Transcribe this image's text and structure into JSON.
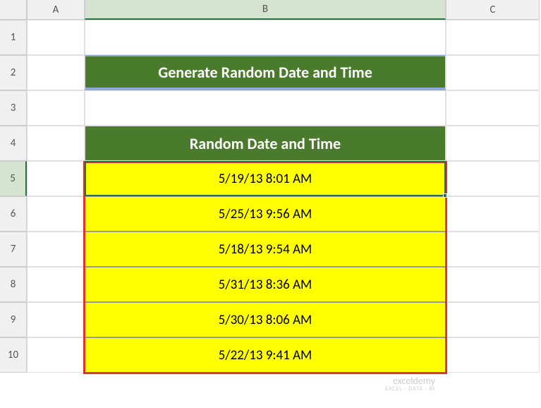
{
  "columns": [
    "A",
    "B",
    "C"
  ],
  "rows": [
    "1",
    "2",
    "3",
    "4",
    "5",
    "6",
    "7",
    "8",
    "9",
    "10"
  ],
  "selected_column": "B",
  "selected_row": "5",
  "title": "Generate Random Date and Time",
  "section_header": "Random Date and Time",
  "data_values": [
    "5/19/13 8:01 AM",
    "5/25/13 9:56 AM",
    "5/18/13 9:54 AM",
    "5/31/13 8:36 AM",
    "5/30/13 8:06 AM",
    "5/22/13 9:41 AM"
  ],
  "watermark": {
    "main": "exceldemy",
    "sub": "EXCEL · DATA · BI"
  },
  "chart_data": {
    "type": "table",
    "title": "Random Date and Time",
    "columns": [
      "Random Date and Time"
    ],
    "rows": [
      [
        "5/19/13 8:01 AM"
      ],
      [
        "5/25/13 9:56 AM"
      ],
      [
        "5/18/13 9:54 AM"
      ],
      [
        "5/31/13 8:36 AM"
      ],
      [
        "5/30/13 8:06 AM"
      ],
      [
        "5/22/13 9:41 AM"
      ]
    ]
  }
}
